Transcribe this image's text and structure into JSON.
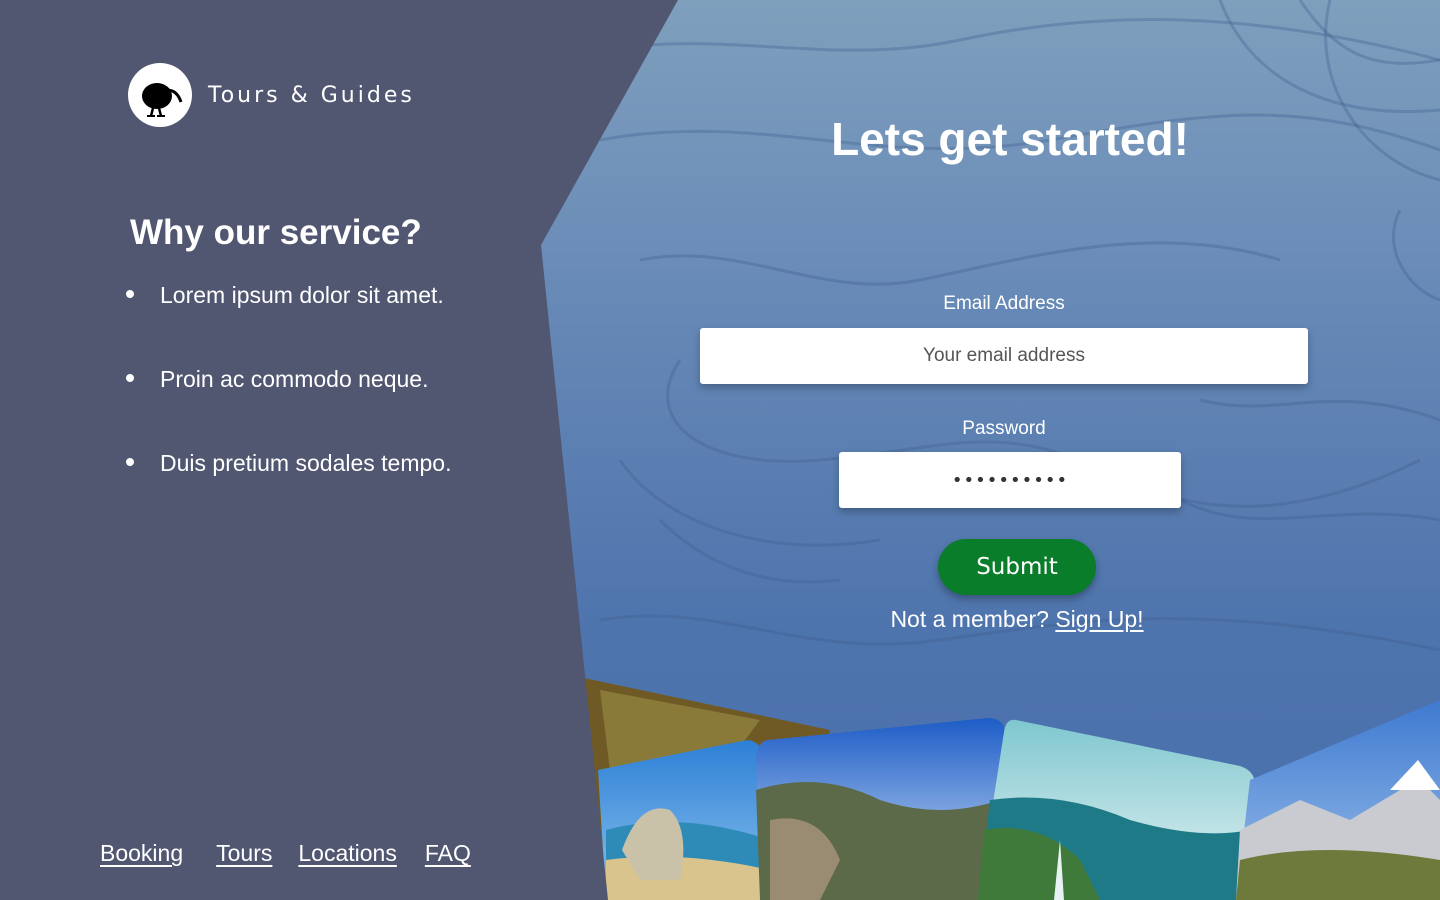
{
  "brand": {
    "name": "Tours & Guides",
    "logo": "kiwi-bird-icon"
  },
  "why": {
    "title": "Why our service?",
    "items": [
      "Lorem ipsum dolor sit amet.",
      "Proin ac commodo neque.",
      "Duis pretium sodales tempo."
    ]
  },
  "footer_nav": {
    "items": [
      "Booking",
      "Tours",
      "Locations",
      "FAQ"
    ]
  },
  "form": {
    "headline": "Lets get started!",
    "email_label": "Email Address",
    "email_placeholder": "Your email address",
    "password_label": "Password",
    "password_value": "••••••••••",
    "submit_label": "Submit",
    "member_prompt": "Not a member?",
    "signup_link": "Sign Up!"
  },
  "colors": {
    "left_panel": "#515671",
    "right_panel": "#5a7db3",
    "submit_button": "#0a7d2b",
    "text": "#ffffff"
  }
}
